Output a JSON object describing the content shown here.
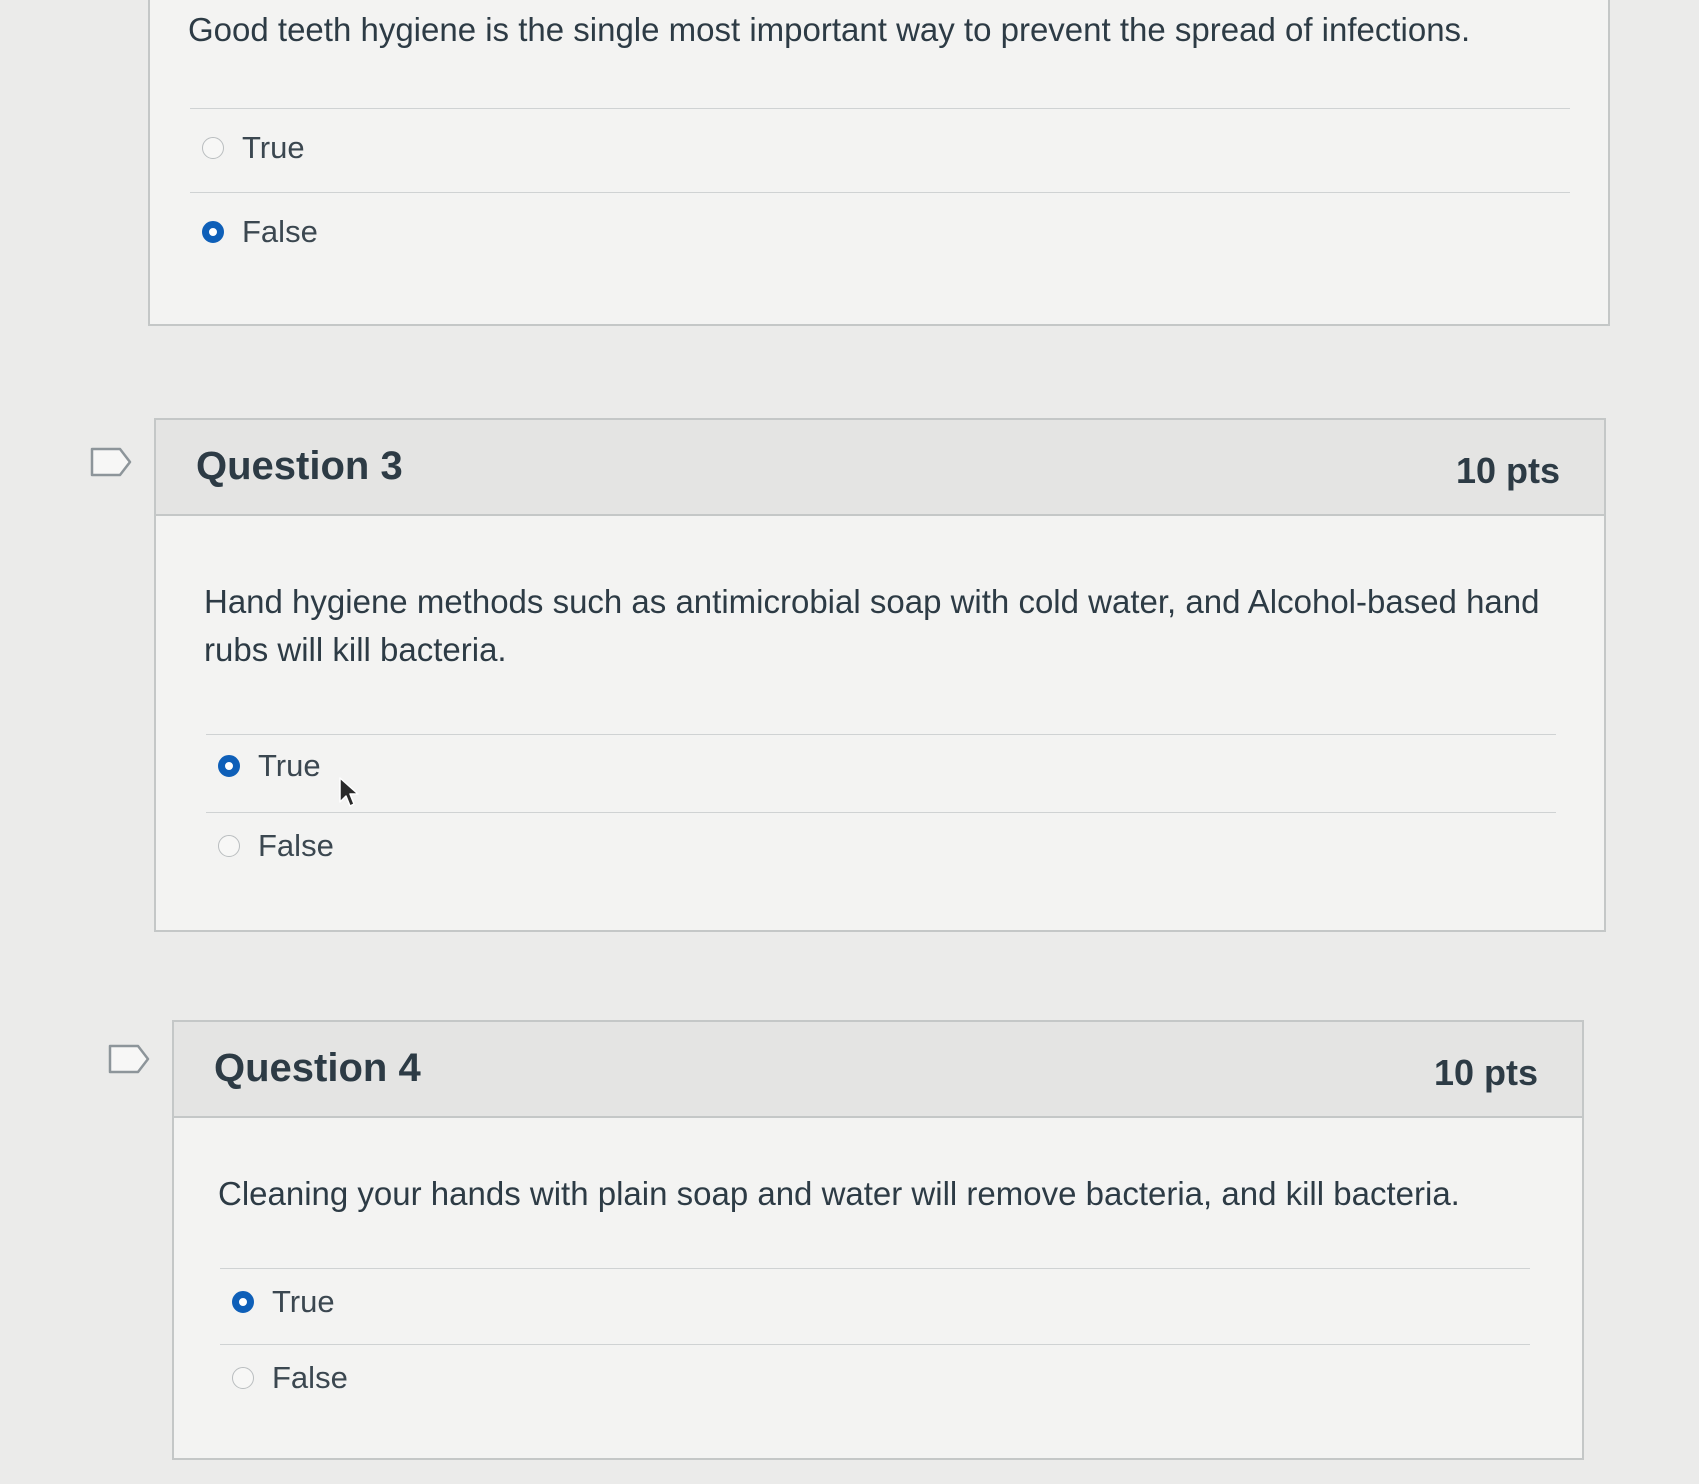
{
  "question2": {
    "text": "Good teeth hygiene is the single most important way to prevent the spread of infections.",
    "answers": [
      {
        "label": "True",
        "selected": false
      },
      {
        "label": "False",
        "selected": true
      }
    ]
  },
  "question3": {
    "title": "Question 3",
    "points": "10 pts",
    "text": "Hand hygiene methods such as antimicrobial soap with cold water, and Alcohol-based hand rubs will kill bacteria.",
    "answers": [
      {
        "label": "True",
        "selected": true
      },
      {
        "label": "False",
        "selected": false
      }
    ]
  },
  "question4": {
    "title": "Question 4",
    "points": "10 pts",
    "text": "Cleaning your hands with plain soap and water will remove bacteria, and kill bacteria.",
    "answers": [
      {
        "label": "True",
        "selected": true
      },
      {
        "label": "False",
        "selected": false
      }
    ]
  },
  "colors": {
    "accent": "#0e5fb8",
    "background": "#ebebea",
    "text": "#2d3b45"
  }
}
